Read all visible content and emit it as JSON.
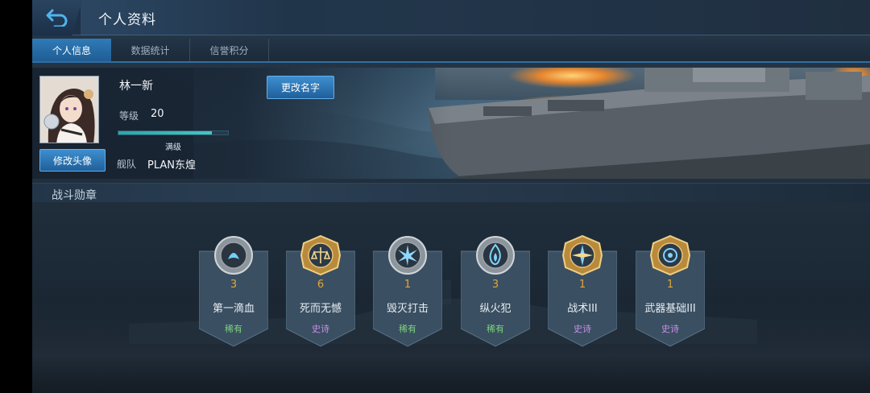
{
  "header": {
    "title": "个人资料",
    "back_icon": "back-arrow-icon"
  },
  "tabs": [
    {
      "label": "个人信息",
      "active": true
    },
    {
      "label": "数据统计",
      "active": false
    },
    {
      "label": "信誉积分",
      "active": false
    }
  ],
  "profile": {
    "name": "林一新",
    "rename_label": "更改名字",
    "change_avatar_label": "修改头像",
    "level_label": "等级",
    "level_value": "20",
    "exp_progress": 0.85,
    "exp_status": "满级",
    "fleet_label": "舰队",
    "fleet_value": "PLAN东煌"
  },
  "section": {
    "title": "战斗勋章"
  },
  "medals": [
    {
      "count": "3",
      "name": "第一滴血",
      "rarity": "稀有",
      "rarity_color": "#7fd17f",
      "emblem": "silver-badge-icon",
      "frame": "silver"
    },
    {
      "count": "6",
      "name": "死而无憾",
      "rarity": "史诗",
      "rarity_color": "#c98fe8",
      "emblem": "gold-scales-badge-icon",
      "frame": "gold"
    },
    {
      "count": "1",
      "name": "毁灭打击",
      "rarity": "稀有",
      "rarity_color": "#7fd17f",
      "emblem": "silver-burst-badge-icon",
      "frame": "silver"
    },
    {
      "count": "3",
      "name": "纵火犯",
      "rarity": "稀有",
      "rarity_color": "#7fd17f",
      "emblem": "silver-flame-badge-icon",
      "frame": "silver"
    },
    {
      "count": "1",
      "name": "战术III",
      "rarity": "史诗",
      "rarity_color": "#c98fe8",
      "emblem": "gold-compass-badge-icon",
      "frame": "gold"
    },
    {
      "count": "1",
      "name": "武器基础III",
      "rarity": "史诗",
      "rarity_color": "#c98fe8",
      "emblem": "gold-target-badge-icon",
      "frame": "gold"
    }
  ],
  "colors": {
    "accent": "#2f7bb8",
    "medal_count": "#e2a53b",
    "exp_fill": "#2aa7a8"
  }
}
